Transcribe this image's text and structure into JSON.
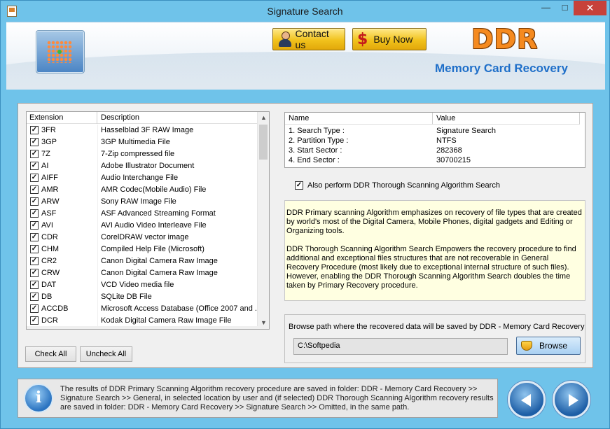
{
  "window": {
    "title": "Signature Search",
    "min_glyph": "—",
    "max_glyph": "□",
    "close_glyph": "✕"
  },
  "header": {
    "contact_label": "Contact us",
    "buy_label": "Buy Now",
    "brand": "DDR",
    "product": "Memory Card Recovery"
  },
  "ext_list": {
    "headers": [
      "Extension",
      "Description"
    ],
    "rows": [
      {
        "ext": "3FR",
        "desc": "Hasselblad 3F RAW Image",
        "checked": true
      },
      {
        "ext": "3GP",
        "desc": "3GP Multimedia File",
        "checked": true
      },
      {
        "ext": "7Z",
        "desc": "7-Zip compressed file",
        "checked": true
      },
      {
        "ext": "AI",
        "desc": "Adobe Illustrator Document",
        "checked": true
      },
      {
        "ext": "AIFF",
        "desc": "Audio Interchange File",
        "checked": true
      },
      {
        "ext": "AMR",
        "desc": "AMR Codec(Mobile Audio) File",
        "checked": true
      },
      {
        "ext": "ARW",
        "desc": "Sony RAW Image File",
        "checked": true
      },
      {
        "ext": "ASF",
        "desc": "ASF Advanced Streaming Format",
        "checked": true
      },
      {
        "ext": "AVI",
        "desc": "AVI Audio Video Interleave File",
        "checked": true
      },
      {
        "ext": "CDR",
        "desc": "CorelDRAW vector image",
        "checked": true
      },
      {
        "ext": "CHM",
        "desc": "Compiled Help File (Microsoft)",
        "checked": true
      },
      {
        "ext": "CR2",
        "desc": "Canon Digital Camera Raw Image",
        "checked": true
      },
      {
        "ext": "CRW",
        "desc": "Canon Digital Camera Raw Image",
        "checked": true
      },
      {
        "ext": "DAT",
        "desc": "VCD Video media file",
        "checked": true
      },
      {
        "ext": "DB",
        "desc": "SQLite DB File",
        "checked": true
      },
      {
        "ext": "ACCDB",
        "desc": "Microsoft Access Database (Office 2007 and ...",
        "checked": true
      },
      {
        "ext": "DCR",
        "desc": "Kodak Digital Camera Raw Image File",
        "checked": true
      }
    ],
    "check_all": "Check All",
    "uncheck_all": "Uncheck All"
  },
  "info": {
    "headers": [
      "Name",
      "Value"
    ],
    "rows": [
      {
        "name": "1. Search Type :",
        "value": "Signature Search"
      },
      {
        "name": "2. Partition Type :",
        "value": "NTFS"
      },
      {
        "name": "3. Start Sector :",
        "value": "282368"
      },
      {
        "name": "4. End Sector :",
        "value": "30700215"
      }
    ]
  },
  "thorough": {
    "label": "Also perform DDR Thorough Scanning Algorithm Search",
    "checked": true
  },
  "description": {
    "p1": "DDR Primary scanning Algorithm emphasizes on recovery of file types that are created by world's most of the Digital Camera, Mobile Phones, digital gadgets and Editing or Organizing tools.",
    "p2": "DDR Thorough Scanning Algorithm Search Empowers the recovery procedure to find additional and exceptional files structures that are not recoverable in General Recovery Procedure (most likely due to exceptional internal structure of such files). However, enabling the DDR Thorough Scanning Algorithm Search doubles the time taken by Primary Recovery procedure."
  },
  "browse": {
    "label": "Browse path where the recovered data will be saved by DDR - Memory Card Recovery",
    "path": "C:\\Softpedia",
    "button": "Browse"
  },
  "status": {
    "info_glyph": "i",
    "text": "The results of DDR Primary Scanning Algorithm recovery procedure are saved in folder: DDR - Memory Card Recovery >> Signature Search >> General, in selected location by user and (if selected) DDR Thorough Scanning Algorithm recovery results are saved in folder: DDR - Memory Card Recovery >> Signature Search >> Omitted, in the same path."
  }
}
